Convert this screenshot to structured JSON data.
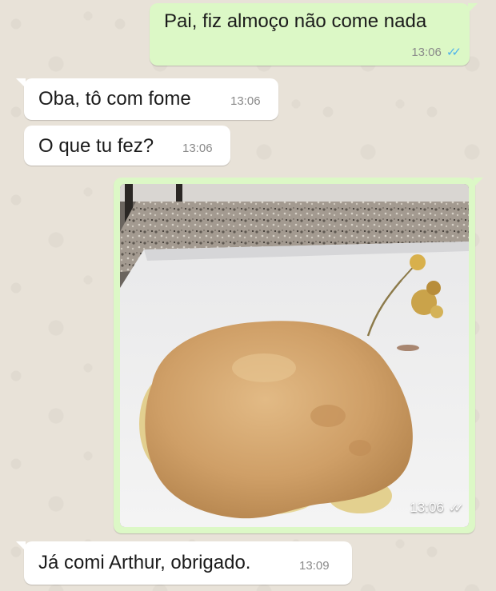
{
  "messages": [
    {
      "text": "Pai, fiz almoço não come nada",
      "time": "13:06",
      "ticks": "✓✓"
    },
    {
      "text": "Oba, tô com fome",
      "time": "13:06"
    },
    {
      "text": "O que tu fez?",
      "time": "13:06"
    },
    {
      "time": "13:06",
      "ticks": "✓✓"
    },
    {
      "text": "Já comi Arthur, obrigado.",
      "time": "13:09"
    }
  ],
  "colors": {
    "outgoing_bubble": "#dcf8c6",
    "incoming_bubble": "#ffffff",
    "read_ticks": "#4fb3ea",
    "chat_background": "#e8e2d8"
  }
}
